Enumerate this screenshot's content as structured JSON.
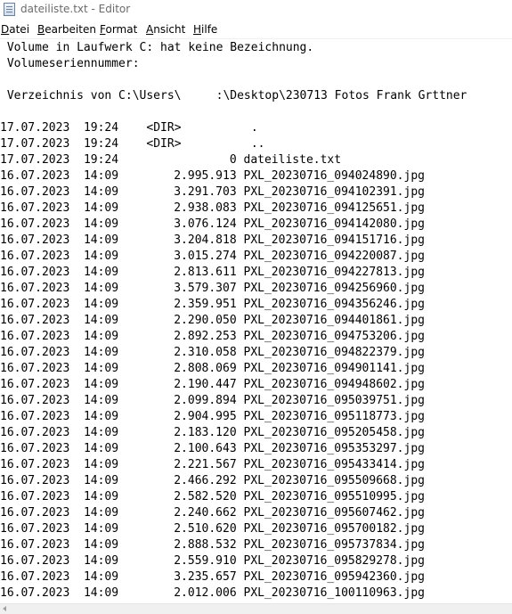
{
  "window": {
    "title": "dateiliste.txt - Editor"
  },
  "menu": [
    {
      "label": "Datei",
      "accel": "D",
      "rest": "atei"
    },
    {
      "label": "Bearbeiten",
      "accel": "B",
      "rest": "earbeiten"
    },
    {
      "label": "Format",
      "accel": "F",
      "rest": "ormat"
    },
    {
      "label": "Ansicht",
      "accel": "A",
      "rest": "nsicht"
    },
    {
      "label": "Hilfe",
      "accel": "H",
      "rest": "ilfe"
    }
  ],
  "document": {
    "header_lines": [
      " Volume in Laufwerk C: hat keine Bezeichnung.",
      " Volumeseriennummer:",
      "",
      " Verzeichnis von C:\\Users\\     :\\Desktop\\230713 Fotos Frank Grttner",
      ""
    ],
    "entries": [
      {
        "date": "17.07.2023",
        "time": "19:24",
        "size": "<DIR>",
        "name": "."
      },
      {
        "date": "17.07.2023",
        "time": "19:24",
        "size": "<DIR>",
        "name": ".."
      },
      {
        "date": "17.07.2023",
        "time": "19:24",
        "size": "0",
        "name": "dateiliste.txt"
      },
      {
        "date": "16.07.2023",
        "time": "14:09",
        "size": "2.995.913",
        "name": "PXL_20230716_094024890.jpg"
      },
      {
        "date": "16.07.2023",
        "time": "14:09",
        "size": "3.291.703",
        "name": "PXL_20230716_094102391.jpg"
      },
      {
        "date": "16.07.2023",
        "time": "14:09",
        "size": "2.938.083",
        "name": "PXL_20230716_094125651.jpg"
      },
      {
        "date": "16.07.2023",
        "time": "14:09",
        "size": "3.076.124",
        "name": "PXL_20230716_094142080.jpg"
      },
      {
        "date": "16.07.2023",
        "time": "14:09",
        "size": "3.204.818",
        "name": "PXL_20230716_094151716.jpg"
      },
      {
        "date": "16.07.2023",
        "time": "14:09",
        "size": "3.015.274",
        "name": "PXL_20230716_094220087.jpg"
      },
      {
        "date": "16.07.2023",
        "time": "14:09",
        "size": "2.813.611",
        "name": "PXL_20230716_094227813.jpg"
      },
      {
        "date": "16.07.2023",
        "time": "14:09",
        "size": "3.579.307",
        "name": "PXL_20230716_094256960.jpg"
      },
      {
        "date": "16.07.2023",
        "time": "14:09",
        "size": "2.359.951",
        "name": "PXL_20230716_094356246.jpg"
      },
      {
        "date": "16.07.2023",
        "time": "14:09",
        "size": "2.290.050",
        "name": "PXL_20230716_094401861.jpg"
      },
      {
        "date": "16.07.2023",
        "time": "14:09",
        "size": "2.892.253",
        "name": "PXL_20230716_094753206.jpg"
      },
      {
        "date": "16.07.2023",
        "time": "14:09",
        "size": "2.310.058",
        "name": "PXL_20230716_094822379.jpg"
      },
      {
        "date": "16.07.2023",
        "time": "14:09",
        "size": "2.808.069",
        "name": "PXL_20230716_094901141.jpg"
      },
      {
        "date": "16.07.2023",
        "time": "14:09",
        "size": "2.190.447",
        "name": "PXL_20230716_094948602.jpg"
      },
      {
        "date": "16.07.2023",
        "time": "14:09",
        "size": "2.099.894",
        "name": "PXL_20230716_095039751.jpg"
      },
      {
        "date": "16.07.2023",
        "time": "14:09",
        "size": "2.904.995",
        "name": "PXL_20230716_095118773.jpg"
      },
      {
        "date": "16.07.2023",
        "time": "14:09",
        "size": "2.183.120",
        "name": "PXL_20230716_095205458.jpg"
      },
      {
        "date": "16.07.2023",
        "time": "14:09",
        "size": "2.100.643",
        "name": "PXL_20230716_095353297.jpg"
      },
      {
        "date": "16.07.2023",
        "time": "14:09",
        "size": "2.221.567",
        "name": "PXL_20230716_095433414.jpg"
      },
      {
        "date": "16.07.2023",
        "time": "14:09",
        "size": "2.466.292",
        "name": "PXL_20230716_095509668.jpg"
      },
      {
        "date": "16.07.2023",
        "time": "14:09",
        "size": "2.582.520",
        "name": "PXL_20230716_095510995.jpg"
      },
      {
        "date": "16.07.2023",
        "time": "14:09",
        "size": "2.240.662",
        "name": "PXL_20230716_095607462.jpg"
      },
      {
        "date": "16.07.2023",
        "time": "14:09",
        "size": "2.510.620",
        "name": "PXL_20230716_095700182.jpg"
      },
      {
        "date": "16.07.2023",
        "time": "14:09",
        "size": "2.888.532",
        "name": "PXL_20230716_095737834.jpg"
      },
      {
        "date": "16.07.2023",
        "time": "14:09",
        "size": "2.559.910",
        "name": "PXL_20230716_095829278.jpg"
      },
      {
        "date": "16.07.2023",
        "time": "14:09",
        "size": "3.235.657",
        "name": "PXL_20230716_095942360.jpg"
      },
      {
        "date": "16.07.2023",
        "time": "14:09",
        "size": "2.012.006",
        "name": "PXL_20230716_100110963.jpg"
      }
    ]
  },
  "icons": {
    "app": "notepad-icon",
    "scroll_left": "scroll-left-arrow-icon"
  }
}
